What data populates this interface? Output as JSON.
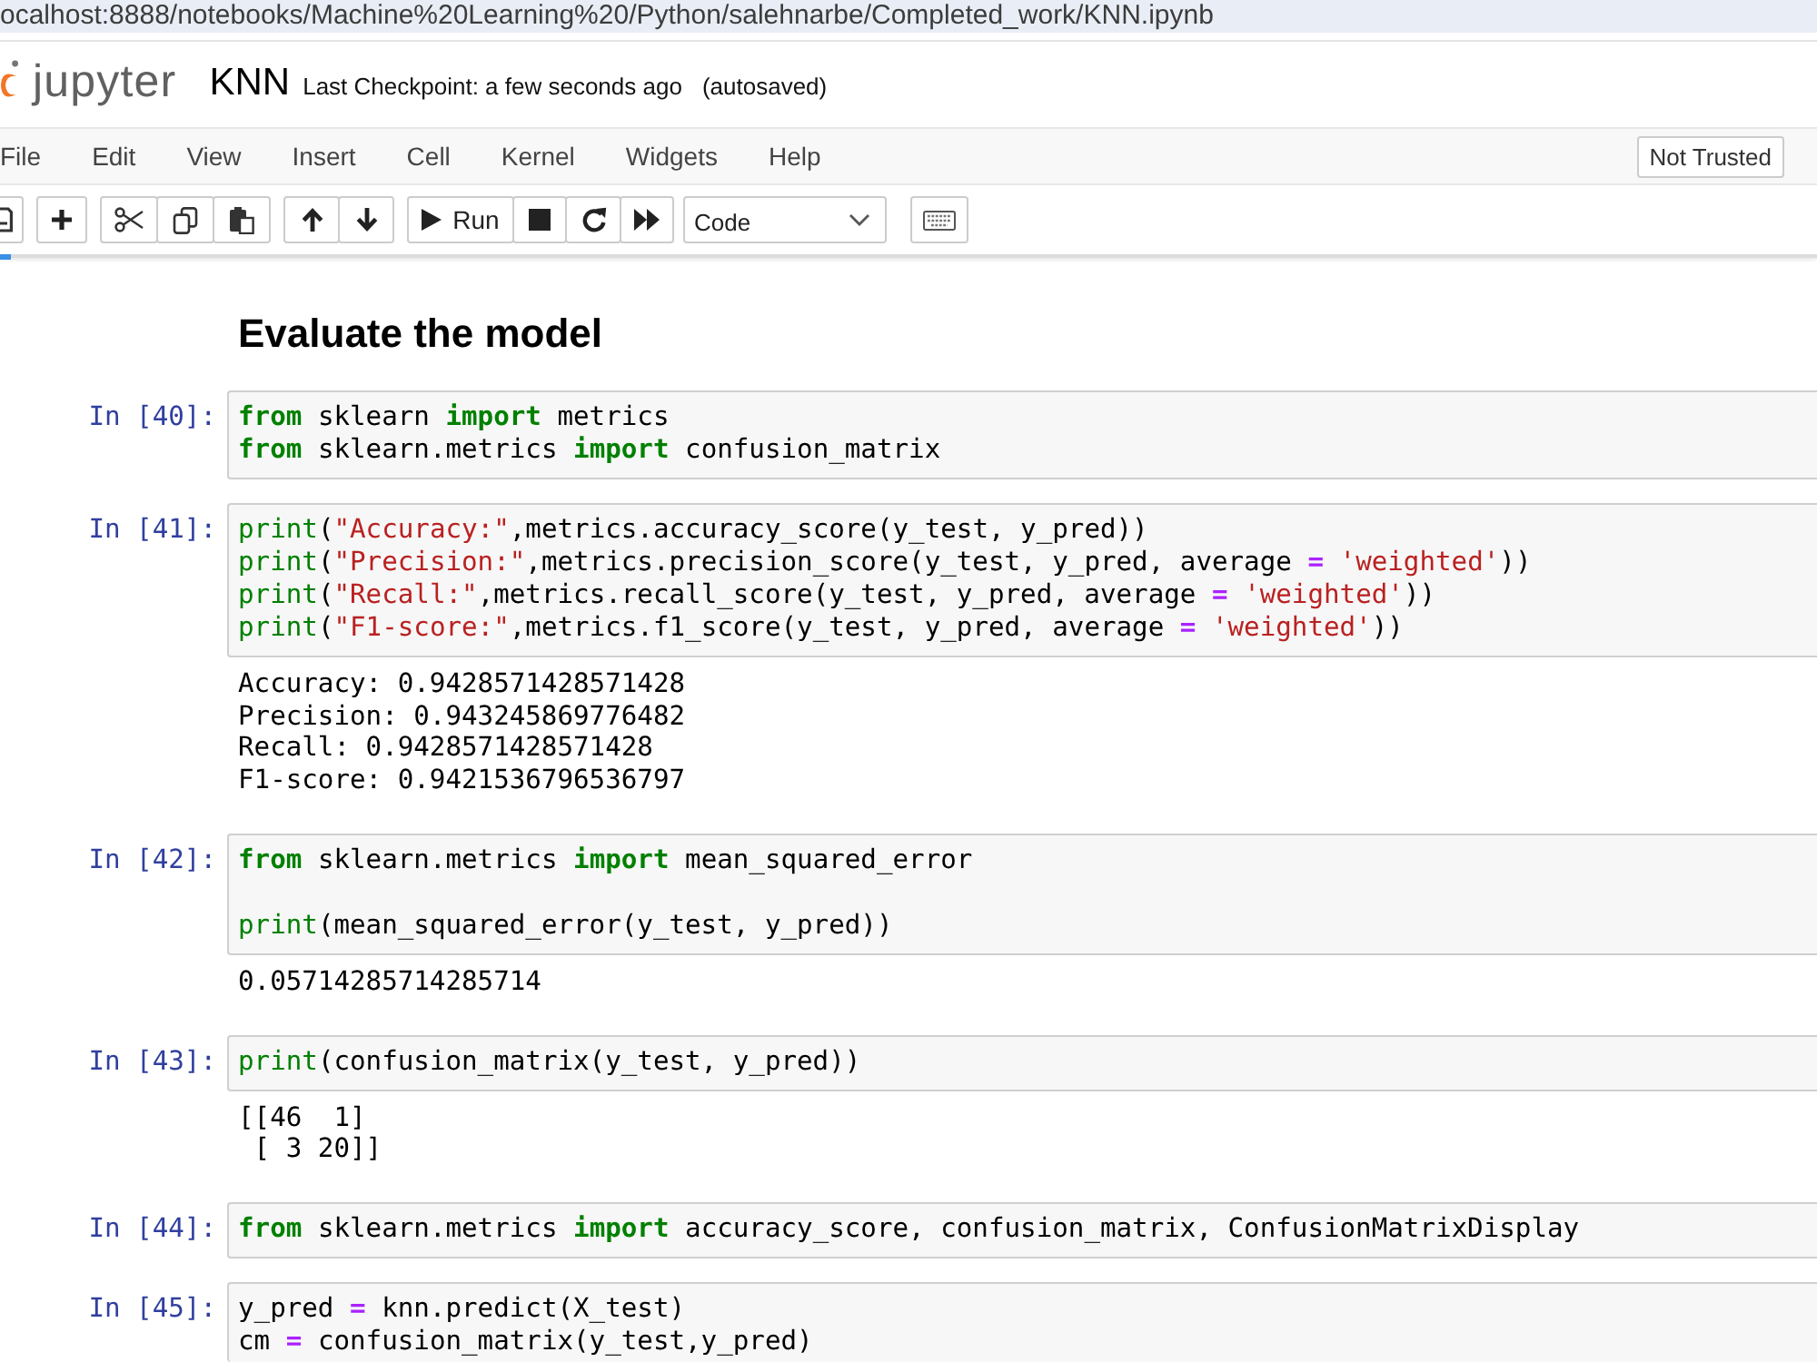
{
  "address_bar": {
    "url": "ocalhost:8888/notebooks/Machine%20Learning%20/Python/salehnarbe/Completed_work/KNN.ipynb"
  },
  "header": {
    "logo_text": "jupyter",
    "notebook_name": "KNN",
    "checkpoint": "Last Checkpoint: a few seconds ago",
    "autosave_status": "(autosaved)"
  },
  "menu": [
    "File",
    "Edit",
    "View",
    "Insert",
    "Cell",
    "Kernel",
    "Widgets",
    "Help"
  ],
  "trust_indicator": "Not Trusted",
  "toolbar": {
    "groups": [
      [
        {
          "kind": "save"
        }
      ],
      [
        {
          "kind": "add"
        }
      ],
      [
        {
          "kind": "cut"
        },
        {
          "kind": "copy"
        },
        {
          "kind": "paste"
        }
      ],
      [
        {
          "kind": "up"
        },
        {
          "kind": "down"
        }
      ],
      [
        {
          "kind": "run",
          "label": "Run"
        },
        {
          "kind": "stop"
        },
        {
          "kind": "restart"
        },
        {
          "kind": "run_all"
        }
      ],
      [
        {
          "kind": "select",
          "value": "Code"
        }
      ],
      [
        {
          "kind": "keyboard"
        }
      ]
    ]
  },
  "notebook": {
    "heading": "Evaluate the model",
    "cells": [
      {
        "prompt": "In [40]:",
        "lines": [
          {
            "kind": "code",
            "tokens": [
              {
                "kind": "keyword",
                "text": "from"
              },
              {
                "kind": "plain",
                "text": " sklearn "
              },
              {
                "kind": "keyword",
                "text": "import"
              },
              {
                "kind": "plain",
                "text": " metrics"
              }
            ]
          },
          {
            "kind": "code",
            "tokens": [
              {
                "kind": "keyword",
                "text": "from"
              },
              {
                "kind": "plain",
                "text": " sklearn.metrics "
              },
              {
                "kind": "keyword",
                "text": "import"
              },
              {
                "kind": "plain",
                "text": " confusion_matrix"
              }
            ]
          }
        ]
      },
      {
        "prompt": "In [41]:",
        "lines": [
          {
            "kind": "code",
            "tokens": [
              {
                "kind": "builtin",
                "text": "print"
              },
              {
                "kind": "plain",
                "text": "("
              },
              {
                "kind": "string",
                "text": "\"Accuracy:\""
              },
              {
                "kind": "plain",
                "text": ",metrics.accuracy_score(y_test, y_pred))"
              }
            ]
          },
          {
            "kind": "code",
            "tokens": [
              {
                "kind": "builtin",
                "text": "print"
              },
              {
                "kind": "plain",
                "text": "("
              },
              {
                "kind": "string",
                "text": "\"Precision:\""
              },
              {
                "kind": "plain",
                "text": ",metrics.precision_score(y_test, y_pred, average"
              },
              {
                "kind": "operator",
                "text": " = "
              },
              {
                "kind": "string",
                "text": "'weighted'"
              },
              {
                "kind": "plain",
                "text": "))"
              }
            ]
          },
          {
            "kind": "code",
            "tokens": [
              {
                "kind": "builtin",
                "text": "print"
              },
              {
                "kind": "plain",
                "text": "("
              },
              {
                "kind": "string",
                "text": "\"Recall:\""
              },
              {
                "kind": "plain",
                "text": ",metrics.recall_score(y_test, y_pred, average"
              },
              {
                "kind": "operator",
                "text": " = "
              },
              {
                "kind": "string",
                "text": "'weighted'"
              },
              {
                "kind": "plain",
                "text": "))"
              }
            ]
          },
          {
            "kind": "code",
            "tokens": [
              {
                "kind": "builtin",
                "text": "print"
              },
              {
                "kind": "plain",
                "text": "("
              },
              {
                "kind": "string",
                "text": "\"F1-score:\""
              },
              {
                "kind": "plain",
                "text": ",metrics.f1_score(y_test, y_pred, average"
              },
              {
                "kind": "operator",
                "text": " = "
              },
              {
                "kind": "string",
                "text": "'weighted'"
              },
              {
                "kind": "plain",
                "text": "))"
              }
            ]
          }
        ],
        "output": [
          "Accuracy: 0.9428571428571428",
          "Precision: 0.943245869776482",
          "Recall: 0.9428571428571428",
          "F1-score: 0.9421536796536797"
        ]
      },
      {
        "prompt": "In [42]:",
        "lines": [
          {
            "kind": "code",
            "tokens": [
              {
                "kind": "keyword",
                "text": "from"
              },
              {
                "kind": "plain",
                "text": " sklearn.metrics "
              },
              {
                "kind": "keyword",
                "text": "import"
              },
              {
                "kind": "plain",
                "text": " mean_squared_error"
              }
            ]
          },
          {
            "kind": "blank"
          },
          {
            "kind": "code",
            "tokens": [
              {
                "kind": "builtin",
                "text": "print"
              },
              {
                "kind": "plain",
                "text": "(mean_squared_error(y_test, y_pred))"
              }
            ]
          }
        ],
        "output": [
          "0.05714285714285714"
        ]
      },
      {
        "prompt": "In [43]:",
        "lines": [
          {
            "kind": "code",
            "tokens": [
              {
                "kind": "builtin",
                "text": "print"
              },
              {
                "kind": "plain",
                "text": "(confusion_matrix(y_test, y_pred))"
              }
            ]
          }
        ],
        "output": [
          "[[46  1]",
          " [ 3 20]]"
        ]
      },
      {
        "prompt": "In [44]:",
        "lines": [
          {
            "kind": "code",
            "tokens": [
              {
                "kind": "keyword",
                "text": "from"
              },
              {
                "kind": "plain",
                "text": " sklearn.metrics "
              },
              {
                "kind": "keyword",
                "text": "import"
              },
              {
                "kind": "plain",
                "text": " accuracy_score, confusion_matrix, ConfusionMatrixDisplay"
              }
            ]
          }
        ]
      },
      {
        "prompt": "In [45]:",
        "lines": [
          {
            "kind": "code",
            "tokens": [
              {
                "kind": "plain",
                "text": "y_pred"
              },
              {
                "kind": "operator",
                "text": " = "
              },
              {
                "kind": "plain",
                "text": "knn.predict(X_test)"
              }
            ]
          },
          {
            "kind": "code",
            "tokens": [
              {
                "kind": "plain",
                "text": "cm"
              },
              {
                "kind": "operator",
                "text": " = "
              },
              {
                "kind": "plain",
                "text": "confusion_matrix(y_test,y_pred)"
              }
            ]
          }
        ]
      }
    ]
  }
}
